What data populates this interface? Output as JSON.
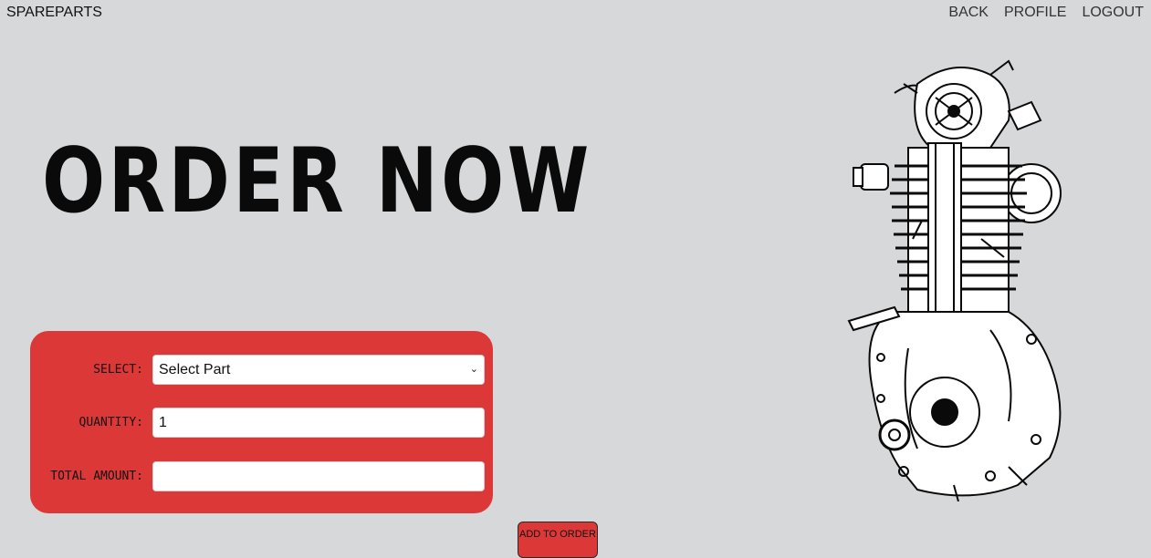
{
  "header": {
    "brand": "SPAREPARTS",
    "nav": [
      "BACK",
      "PROFILE",
      "LOGOUT"
    ]
  },
  "hero": {
    "title": "ORDER NOW"
  },
  "form": {
    "select_label": "SELECT:",
    "select_value": "Select Part",
    "quantity_label": "QUANTITY:",
    "quantity_value": "1",
    "total_label": "TOTAL AMOUNT:",
    "total_value": ""
  },
  "actions": {
    "add_to_order": "ADD TO ORDER"
  },
  "illustration": {
    "icon": "engine-illustration-icon"
  },
  "colors": {
    "background": "#d7d8da",
    "accent": "#dc3838"
  }
}
